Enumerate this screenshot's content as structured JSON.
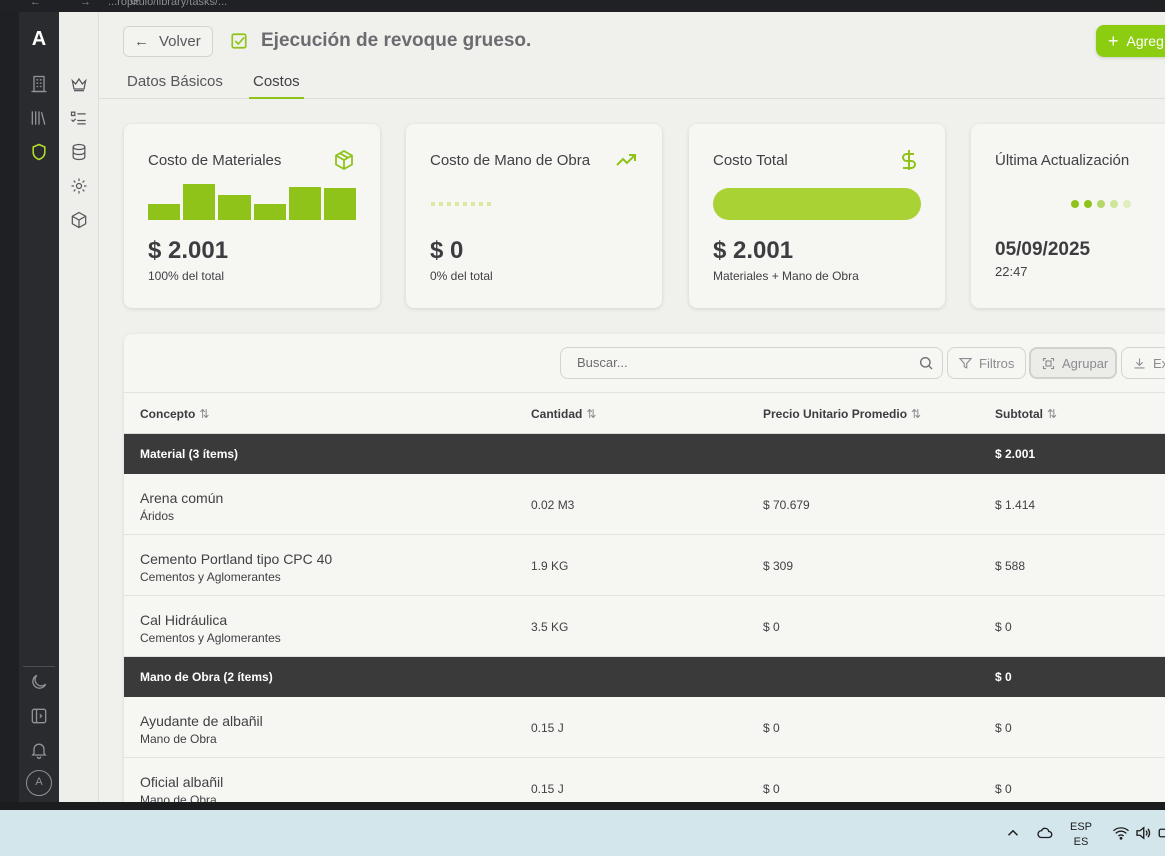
{
  "browser": {
    "url": "...ropitulo/library/tasks/...",
    "nav": "← → ⟳"
  },
  "rail": {
    "logo": "A",
    "avatar": "A"
  },
  "header": {
    "back_label": "Volver",
    "title": "Ejecución de revoque grueso.",
    "add_label": "Agreg"
  },
  "tabs": [
    {
      "label": "Datos Básicos"
    },
    {
      "label": "Costos"
    }
  ],
  "cards": {
    "materials": {
      "label": "Costo de Materiales",
      "value": "$ 2.001",
      "sub": "100% del total"
    },
    "labor": {
      "label": "Costo de Mano de Obra",
      "value": "$ 0",
      "sub": "0% del total"
    },
    "total": {
      "label": "Costo Total",
      "value": "$ 2.001",
      "sub": "Materiales + Mano de Obra"
    },
    "updated": {
      "label": "Última Actualización",
      "date": "05/09/2025",
      "time": "22:47"
    }
  },
  "toolbar": {
    "search_placeholder": "Buscar...",
    "filters_label": "Filtros",
    "group_label": "Agrupar",
    "export_label": "Ex"
  },
  "table": {
    "columns": [
      "Concepto",
      "Cantidad",
      "Precio Unitario Promedio",
      "Subtotal"
    ],
    "groups": [
      {
        "label": "Material (3 ítems)",
        "subtotal": "$ 2.001"
      },
      {
        "label": "Mano de Obra (2 ítems)",
        "subtotal": "$ 0"
      }
    ],
    "rows": [
      {
        "name": "Arena común",
        "category": "Áridos",
        "quantity": "0.02 M3",
        "unit_price": "$ 70.679",
        "subtotal": "$ 1.414"
      },
      {
        "name": "Cemento Portland tipo CPC 40",
        "category": "Cementos y Aglomerantes",
        "quantity": "1.9 KG",
        "unit_price": "$ 309",
        "subtotal": "$ 588"
      },
      {
        "name": "Cal Hidráulica",
        "category": "Cementos y Aglomerantes",
        "quantity": "3.5 KG",
        "unit_price": "$ 0",
        "subtotal": "$ 0"
      },
      {
        "name": "Ayudante de albañil",
        "category": "Mano de Obra",
        "quantity": "0.15 J",
        "unit_price": "$ 0",
        "subtotal": "$ 0"
      },
      {
        "name": "Oficial albañil",
        "category": "Mano de Obra",
        "quantity": "0.15 J",
        "unit_price": "$ 0",
        "subtotal": "$ 0"
      }
    ]
  },
  "taskbar": {
    "lang_top": "ESP",
    "lang_bottom": "ES"
  },
  "colors": {
    "accent": "#8fc31a",
    "group_row": "#3a3a3a"
  }
}
